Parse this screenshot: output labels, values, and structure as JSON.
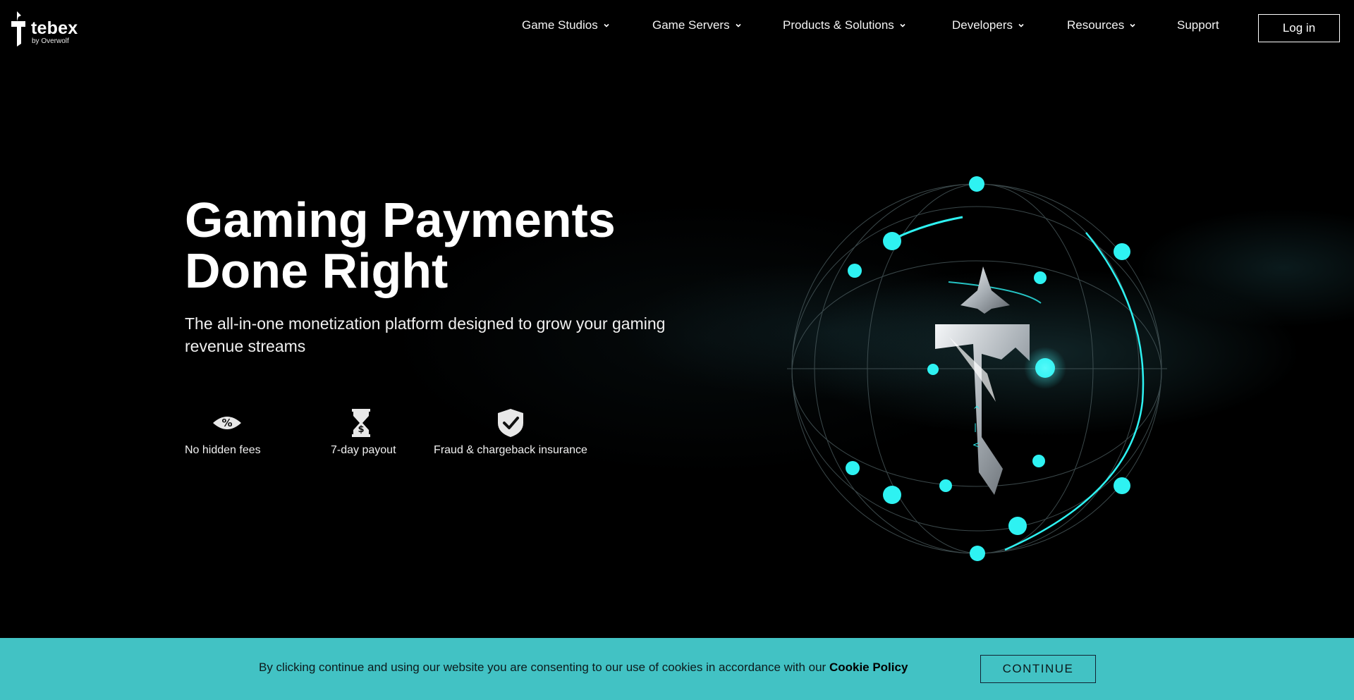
{
  "brand": {
    "name": "tebex",
    "tagline": "by Overwolf",
    "logo_icon": "tebex-cross-icon"
  },
  "nav": {
    "items": [
      {
        "label": "Game Studios",
        "has_dropdown": true
      },
      {
        "label": "Game Servers",
        "has_dropdown": true
      },
      {
        "label": "Products & Solutions",
        "has_dropdown": true
      },
      {
        "label": "Developers",
        "has_dropdown": true
      },
      {
        "label": "Resources",
        "has_dropdown": true
      },
      {
        "label": "Support",
        "has_dropdown": false
      }
    ],
    "login_label": "Log in"
  },
  "hero": {
    "title_line1": "Gaming Payments",
    "title_line2": "Done Right",
    "subtitle": "The all-in-one monetization platform designed to grow your gaming revenue streams",
    "features": [
      {
        "icon": "percent-eye-icon",
        "label": "No hidden fees"
      },
      {
        "icon": "hourglass-dollar-icon",
        "label": "7-day payout"
      },
      {
        "icon": "shield-check-icon",
        "label": "Fraud & chargeback insurance"
      }
    ]
  },
  "cookie": {
    "text": "By clicking continue and using our website you are consenting to our use of cookies in accordance with our",
    "policy_link": "Cookie Policy",
    "continue_label": "CONTINUE"
  },
  "colors": {
    "accent": "#42c2c4",
    "node": "#2ef2f2",
    "background": "#000000"
  }
}
